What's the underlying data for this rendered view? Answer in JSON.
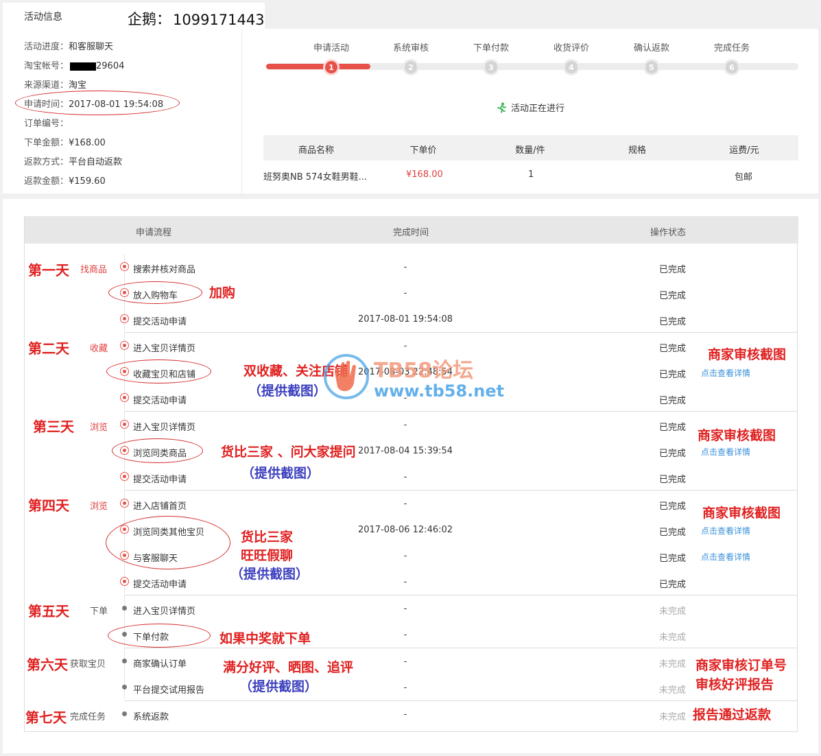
{
  "header": {
    "section_title": "活动信息",
    "qq_label": "企鹅：",
    "qq_number": "1099171443"
  },
  "info": {
    "progress_label": "活动进度：",
    "progress_value": "和客服聊天",
    "account_label": "淘宝帐号：",
    "account_value_suffix": "29604",
    "channel_label": "来源渠道：",
    "channel_value": "淘宝",
    "apply_time_label": "申请时间：",
    "apply_time_value": "2017-08-01 19:54:08",
    "order_no_label": "订单编号：",
    "order_no_value": "",
    "order_amount_label": "下单金额：",
    "order_amount_value": "¥168.00",
    "refund_method_label": "返款方式：",
    "refund_method_value": "平台自动返款",
    "refund_amount_label": "返款金额：",
    "refund_amount_value": "¥159.60"
  },
  "progress": {
    "current_step": 1,
    "steps": [
      {
        "num": "1",
        "label": "申请活动"
      },
      {
        "num": "2",
        "label": "系统审核"
      },
      {
        "num": "3",
        "label": "下单付款"
      },
      {
        "num": "4",
        "label": "收货评价"
      },
      {
        "num": "5",
        "label": "确认返款"
      },
      {
        "num": "6",
        "label": "完成任务"
      }
    ],
    "running_text": "活动正在进行",
    "accent_color": "#e8504a"
  },
  "goods": {
    "headers": [
      "商品名称",
      "下单价",
      "数量/件",
      "规格",
      "运费/元"
    ],
    "row": {
      "name": "班努奥NB 574女鞋男鞋...",
      "price": "¥168.00",
      "qty": "1",
      "spec": "",
      "shipping": "包邮"
    }
  },
  "table": {
    "headers": [
      "申请流程",
      "完成时间",
      "操作状态"
    ],
    "detail_link_text": "点击查看详情",
    "rows": [
      {
        "name": "搜索并核对商品",
        "time": "-",
        "status": "已完成",
        "done": true,
        "link": false
      },
      {
        "name": "放入购物车",
        "time": "-",
        "status": "已完成",
        "done": true,
        "link": false
      },
      {
        "name": "提交活动申请",
        "time": "2017-08-01 19:54:08",
        "status": "已完成",
        "done": true,
        "link": false
      },
      {
        "name": "进入宝贝详情页",
        "time": "-",
        "status": "已完成",
        "done": true,
        "link": false
      },
      {
        "name": "收藏宝贝和店铺",
        "time": "2017-08-03 22:48:54",
        "status": "已完成",
        "done": true,
        "link": true
      },
      {
        "name": "提交活动申请",
        "time": "-",
        "status": "已完成",
        "done": true,
        "link": false
      },
      {
        "name": "进入宝贝详情页",
        "time": "-",
        "status": "已完成",
        "done": true,
        "link": false
      },
      {
        "name": "浏览同类商品",
        "time": "2017-08-04 15:39:54",
        "status": "已完成",
        "done": true,
        "link": true
      },
      {
        "name": "提交活动申请",
        "time": "-",
        "status": "已完成",
        "done": true,
        "link": false
      },
      {
        "name": "进入店铺首页",
        "time": "-",
        "status": "已完成",
        "done": true,
        "link": false
      },
      {
        "name": "浏览同类其他宝贝",
        "time": "2017-08-06 12:46:02",
        "status": "已完成",
        "done": true,
        "link": true
      },
      {
        "name": "与客服聊天",
        "time": "-",
        "status": "已完成",
        "done": true,
        "link": true
      },
      {
        "name": "提交活动申请",
        "time": "-",
        "status": "已完成",
        "done": true,
        "link": false
      },
      {
        "name": "进入宝贝详情页",
        "time": "-",
        "status": "未完成",
        "done": false,
        "link": false
      },
      {
        "name": "下单付款",
        "time": "-",
        "status": "未完成",
        "done": false,
        "link": false
      },
      {
        "name": "商家确认订单",
        "time": "-",
        "status": "未完成",
        "done": false,
        "link": false
      },
      {
        "name": "平台提交试用报告",
        "time": "-",
        "status": "未完成",
        "done": false,
        "link": false
      },
      {
        "name": "系统返款",
        "time": "-",
        "status": "未完成",
        "done": false,
        "link": false
      }
    ]
  },
  "days": [
    {
      "title": "第一天",
      "sub": "找商品"
    },
    {
      "title": "第二天",
      "sub": "收藏"
    },
    {
      "title": "第三天",
      "sub": "浏览"
    },
    {
      "title": "第四天",
      "sub": "浏览"
    },
    {
      "title": "第五天",
      "sub": "下单"
    },
    {
      "title": "第六天",
      "sub": "获取宝贝"
    },
    {
      "title": "第七天",
      "sub": "完成任务"
    }
  ],
  "annotations": {
    "add_cart": "加购",
    "double_fav": "双收藏、关注店铺",
    "provide_shot_1": "（提供截图）",
    "compare_ask": "货比三家 、问大家提问",
    "provide_shot_2": "（提供截图）",
    "compare": "货比三家",
    "fake_chat": "旺旺假聊",
    "provide_shot_3": "（提供截图）",
    "order_if_win": "如果中奖就下单",
    "review": "满分好评、晒图、追评",
    "provide_shot_4": "（提供截图）",
    "merchant_shot_1": "商家审核截图",
    "merchant_shot_2": "商家审核截图",
    "merchant_shot_3": "商家审核截图",
    "merchant_order_no": "商家审核订单号",
    "merchant_review": "审核好评报告",
    "refund_after_report": "报告通过返款"
  },
  "watermark": {
    "title": "TB58论坛",
    "url": "www.tb58.net"
  }
}
